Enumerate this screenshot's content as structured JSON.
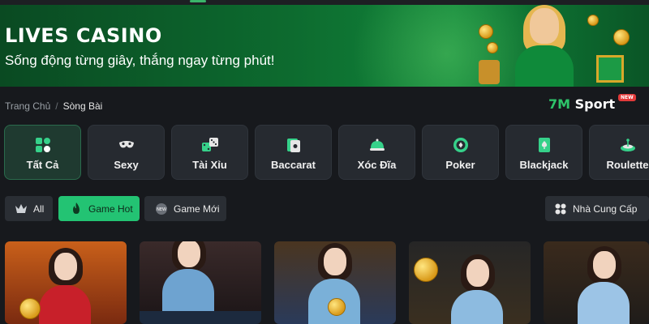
{
  "banner": {
    "title": "LIVES CASINO",
    "subtitle": "Sống động từng giây, thắng ngay từng phút!"
  },
  "breadcrumb": {
    "home": "Trang Chủ",
    "separator": "/",
    "current": "Sòng Bài"
  },
  "brand": {
    "prefix": "7M",
    "name": "Sport",
    "badge": "NEW"
  },
  "categories": [
    {
      "label": "Tất Cả",
      "icon": "grid-shapes-icon",
      "active": true
    },
    {
      "label": "Sexy",
      "icon": "mask-icon",
      "active": false
    },
    {
      "label": "Tài Xỉu",
      "icon": "dice-icon",
      "active": false
    },
    {
      "label": "Baccarat",
      "icon": "cards-icon",
      "active": false
    },
    {
      "label": "Xóc Đĩa",
      "icon": "cloche-icon",
      "active": false
    },
    {
      "label": "Poker",
      "icon": "chip-icon",
      "active": false
    },
    {
      "label": "Blackjack",
      "icon": "spade-card-icon",
      "active": false
    },
    {
      "label": "Roulette",
      "icon": "roulette-icon",
      "active": false
    }
  ],
  "filters": {
    "all": "All",
    "hot": "Game Hot",
    "new": "Game Mới",
    "provider": "Nhà Cung Cấp"
  },
  "colors": {
    "accent": "#23c373",
    "page_bg": "#17191d",
    "card_bg": "#262a30"
  }
}
